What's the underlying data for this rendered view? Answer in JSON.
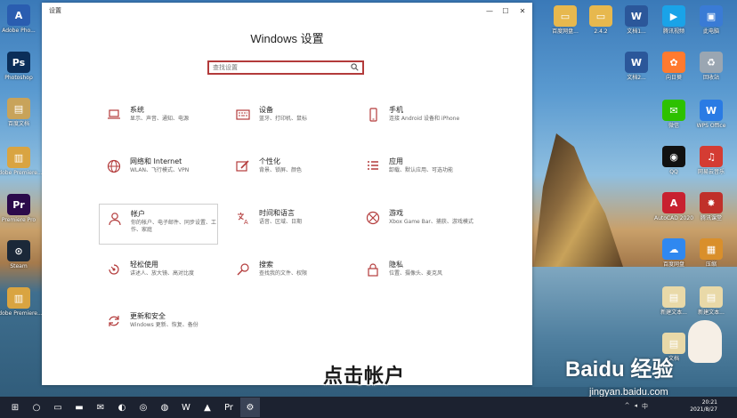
{
  "desktop": {
    "left_icons": [
      {
        "name": "desktop-icon-tutorial",
        "label": "Adobe Pho...",
        "color": "#2a5db0",
        "glyph": "A"
      },
      {
        "name": "desktop-icon-photoshop",
        "label": "Photoshop",
        "color": "#0b2e59",
        "glyph": "Ps"
      },
      {
        "name": "desktop-icon-notes",
        "label": "百度文档",
        "color": "#c8a35a",
        "glyph": "▤"
      },
      {
        "name": "desktop-icon-adobe-premiere-1",
        "label": "Adobe Premiere...",
        "color": "#d9a441",
        "glyph": "▥"
      },
      {
        "name": "desktop-icon-premiere",
        "label": "Premiere Pro",
        "color": "#2b0a4b",
        "glyph": "Pr"
      },
      {
        "name": "desktop-icon-steam",
        "label": "Steam",
        "color": "#1b2838",
        "glyph": "⊙"
      },
      {
        "name": "desktop-icon-adobe-premiere-2",
        "label": "Adobe Premiere...",
        "color": "#d9a441",
        "glyph": "▥"
      }
    ],
    "right_icons": [
      {
        "name": "desktop-icon-folder-1",
        "label": "百度网盘...",
        "color": "#e7b84e",
        "glyph": "▭"
      },
      {
        "name": "desktop-icon-folder-2",
        "label": "2.4.2",
        "color": "#e7b84e",
        "glyph": "▭"
      },
      {
        "name": "desktop-icon-word-1",
        "label": "文档1...",
        "color": "#2b579a",
        "glyph": "W"
      },
      {
        "name": "desktop-icon-tencent-video",
        "label": "腾讯视频",
        "color": "#1aa3e8",
        "glyph": "▶"
      },
      {
        "name": "desktop-icon-pc",
        "label": "此电脑",
        "color": "#3a7bd5",
        "glyph": "▣"
      },
      {
        "name": "desktop-icon-word-2",
        "label": "文档2...",
        "color": "#2b579a",
        "glyph": "W"
      },
      {
        "name": "desktop-icon-app-orange",
        "label": "向日葵",
        "color": "#ff7a2f",
        "glyph": "✿"
      },
      {
        "name": "desktop-icon-recycle",
        "label": "回收站",
        "color": "#9aa6b2",
        "glyph": "♻"
      },
      {
        "name": "desktop-icon-wechat",
        "label": "微信",
        "color": "#2dc100",
        "glyph": "✉"
      },
      {
        "name": "desktop-icon-wps",
        "label": "WPS Office",
        "color": "#2a7be4",
        "glyph": "W"
      },
      {
        "name": "desktop-icon-qq",
        "label": "QQ",
        "color": "#111111",
        "glyph": "◉"
      },
      {
        "name": "desktop-icon-netease-music",
        "label": "网易云音乐",
        "color": "#d43c33",
        "glyph": "♫"
      },
      {
        "name": "desktop-icon-autodesk",
        "label": "AutoCAD 2020",
        "color": "#c8202f",
        "glyph": "A"
      },
      {
        "name": "desktop-icon-app-red",
        "label": "腾讯课堂",
        "color": "#c0302a",
        "glyph": "✸"
      },
      {
        "name": "desktop-icon-app-blue",
        "label": "百度网盘",
        "color": "#2f88f0",
        "glyph": "☁"
      },
      {
        "name": "desktop-icon-app-pack",
        "label": "压缩",
        "color": "#d98f2b",
        "glyph": "▦"
      },
      {
        "name": "desktop-icon-doc-1",
        "label": "新建文本...",
        "color": "#e9d9a8",
        "glyph": "▤"
      },
      {
        "name": "desktop-icon-doc-2",
        "label": "新建文本...",
        "color": "#e9d9a8",
        "glyph": "▤"
      },
      {
        "name": "desktop-icon-doc-3",
        "label": "文档",
        "color": "#e9d9a8",
        "glyph": "▤"
      }
    ]
  },
  "window": {
    "title": "设置",
    "minimize": "—",
    "maximize": "☐",
    "close": "✕",
    "heading": "Windows 设置",
    "search_placeholder": "查找设置",
    "search_icon": "search-icon",
    "accent": "#b33b3b"
  },
  "categories": [
    {
      "id": "system",
      "icon": "laptop-icon",
      "title": "系统",
      "desc": "显示、声音、通知、电源"
    },
    {
      "id": "devices",
      "icon": "keyboard-icon",
      "title": "设备",
      "desc": "蓝牙、打印机、鼠标"
    },
    {
      "id": "phone",
      "icon": "phone-icon",
      "title": "手机",
      "desc": "连接 Android 设备和 iPhone"
    },
    {
      "id": "network",
      "icon": "globe-icon",
      "title": "网络和 Internet",
      "desc": "WLAN、飞行模式、VPN"
    },
    {
      "id": "personalization",
      "icon": "brush-icon",
      "title": "个性化",
      "desc": "背景、锁屏、颜色"
    },
    {
      "id": "apps",
      "icon": "apps-list-icon",
      "title": "应用",
      "desc": "卸载、默认应用、可选功能"
    },
    {
      "id": "accounts",
      "icon": "person-icon",
      "title": "帐户",
      "desc": "你的帐户、电子邮件、同步设置、工作、家庭"
    },
    {
      "id": "time-language",
      "icon": "time-language-icon",
      "title": "时间和语言",
      "desc": "语音、区域、日期"
    },
    {
      "id": "gaming",
      "icon": "xbox-icon",
      "title": "游戏",
      "desc": "Xbox Game Bar、捕获、游戏模式"
    },
    {
      "id": "ease-of-access",
      "icon": "ease-of-access-icon",
      "title": "轻松使用",
      "desc": "讲述人、放大镜、高对比度"
    },
    {
      "id": "search",
      "icon": "magnifier-icon",
      "title": "搜索",
      "desc": "查找我的文件、权限"
    },
    {
      "id": "privacy",
      "icon": "lock-icon",
      "title": "隐私",
      "desc": "位置、摄像头、麦克风"
    },
    {
      "id": "update-security",
      "icon": "refresh-icon",
      "title": "更新和安全",
      "desc": "Windows 更新、恢复、备份"
    }
  ],
  "overlay": {
    "subtitle": "点击帐户",
    "watermark": "Baidu 经验",
    "watermark_url": "jingyan.baidu.com"
  },
  "taskbar": {
    "items": [
      {
        "name": "start-button",
        "glyph": "⊞"
      },
      {
        "name": "search-taskbar-icon",
        "glyph": "○"
      },
      {
        "name": "task-view-icon",
        "glyph": "▭"
      },
      {
        "name": "file-explorer-icon",
        "glyph": "▬"
      },
      {
        "name": "mail-icon",
        "glyph": "✉"
      },
      {
        "name": "app-yellow-icon",
        "glyph": "◐"
      },
      {
        "name": "chrome-icon",
        "glyph": "◎"
      },
      {
        "name": "browser-icon",
        "glyph": "◍"
      },
      {
        "name": "word-icon",
        "glyph": "W"
      },
      {
        "name": "app-red-icon",
        "glyph": "▲"
      },
      {
        "name": "premiere-icon",
        "glyph": "Pr"
      },
      {
        "name": "settings-gear-icon",
        "glyph": "⚙"
      }
    ],
    "time": "20:21",
    "date": "2021/8/27",
    "tray": [
      "^",
      "◂",
      "中"
    ]
  }
}
